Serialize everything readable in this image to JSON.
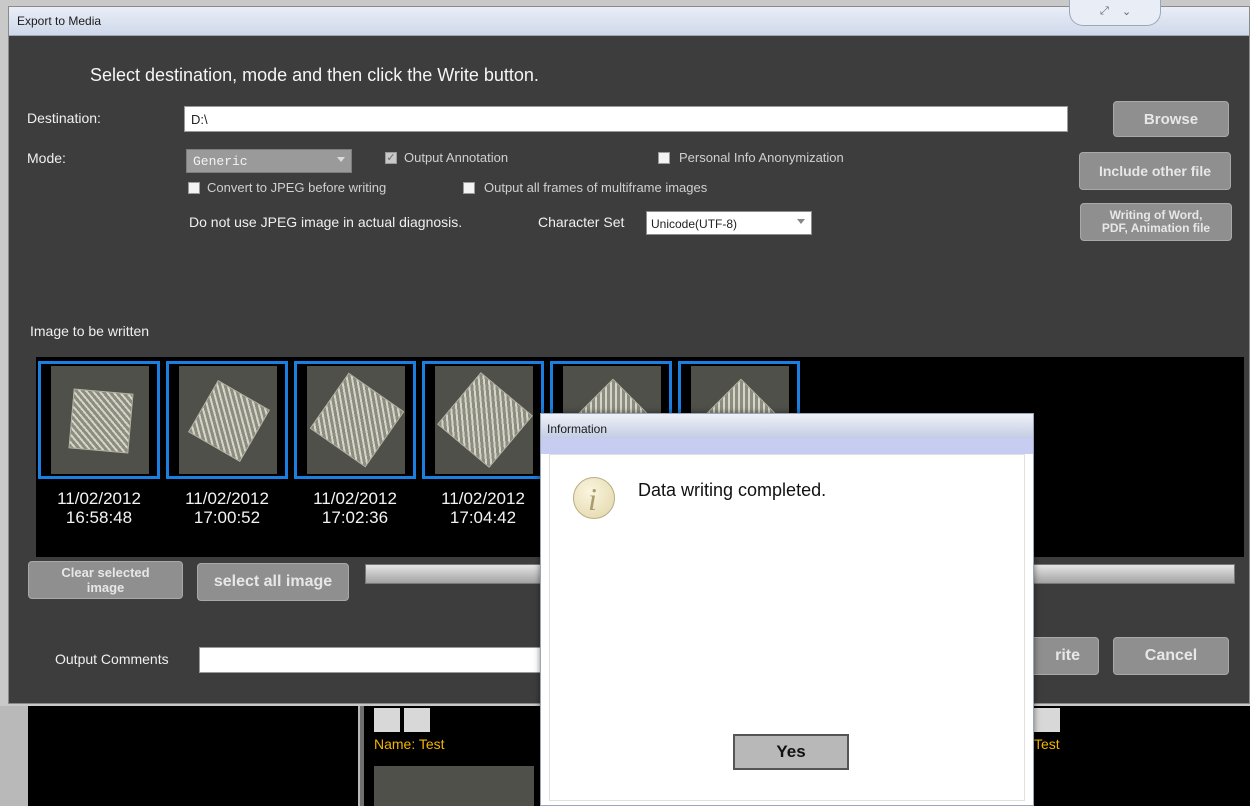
{
  "export_dialog": {
    "title": "Export to Media",
    "instruction": "Select destination, mode and then click the Write button.",
    "destination_label": "Destination:",
    "destination_value": "D:\\",
    "mode_label": "Mode:",
    "mode_value": "Generic",
    "output_annotation_label": "Output Annotation",
    "output_annotation_checked": true,
    "personal_info_label": "Personal Info Anonymization",
    "personal_info_checked": false,
    "convert_jpeg_label": "Convert to JPEG before writing",
    "convert_jpeg_checked": false,
    "output_all_frames_label": "Output all frames of multiframe images",
    "output_all_frames_checked": false,
    "jpeg_warning": "Do not use JPEG image in actual diagnosis.",
    "charset_label": "Character Set",
    "charset_value": "Unicode(UTF-8)",
    "browse_button": "Browse",
    "include_other_button": "Include other file",
    "writing_word_button_line1": "Writing of Word,",
    "writing_word_button_line2": "PDF, Animation file",
    "image_section_label": "Image to be written",
    "thumbnails": [
      {
        "date": "11/02/2012",
        "time": "16:58:48"
      },
      {
        "date": "11/02/2012",
        "time": "17:00:52"
      },
      {
        "date": "11/02/2012",
        "time": "17:02:36"
      },
      {
        "date": "11/02/2012",
        "time": "17:04:42"
      }
    ],
    "clear_selected_line1": "Clear selected",
    "clear_selected_line2": "image",
    "select_all_button": "select all image",
    "output_comments_label": "Output Comments",
    "write_button_visible": "rite",
    "cancel_button": "Cancel"
  },
  "background": {
    "patient_name_left": "Name: Test",
    "patient_name_right": "Test"
  },
  "info_dialog": {
    "title": "Information",
    "message": "Data writing completed.",
    "yes_button": "Yes",
    "icon": "info-icon"
  },
  "colors": {
    "dialog_bg": "#3d3d3d",
    "thumb_border": "#1a7fe0",
    "name_text": "#f4b400"
  }
}
